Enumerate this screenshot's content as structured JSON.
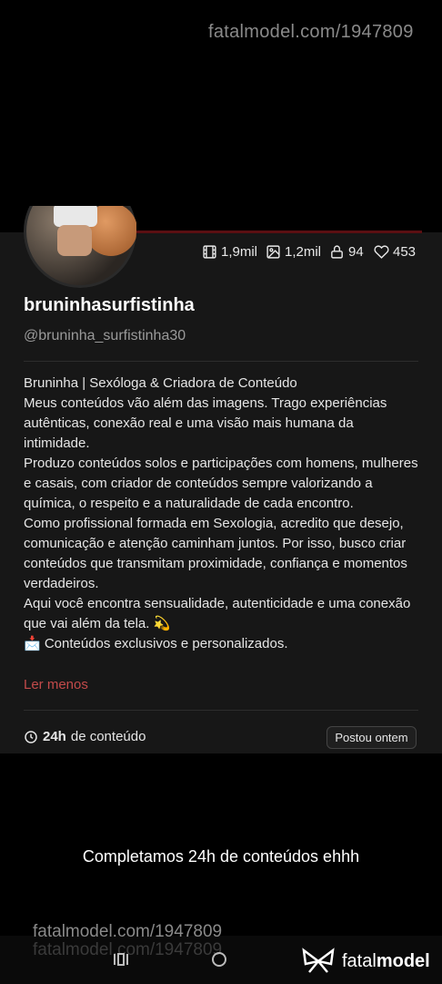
{
  "watermark": "fatalmodel.com/1947809",
  "profile": {
    "username": "bruninhasurfistinha",
    "handle": "@bruninha_surfistinha30"
  },
  "stats": {
    "videos": "1,9mil",
    "photos": "1,2mil",
    "locked": "94",
    "likes": "453"
  },
  "bio": [
    "Bruninha | Sexóloga & Criadora de Conteúdo",
    "Meus conteúdos vão além das imagens. Trago experiências autênticas, conexão real e uma visão mais humana da intimidade.",
    "Produzo conteúdos solos e participações com homens, mulheres e casais, com criador de conteúdos sempre valorizando a química, o respeito e a naturalidade de cada encontro.",
    "Como profissional formada em Sexologia, acredito que desejo, comunicação e atenção caminham juntos. Por isso, busco criar conteúdos que transmitam proximidade, confiança e momentos verdadeiros.",
    "Aqui você encontra sensualidade, autenticidade e uma conexão que vai além da tela. 💫",
    "📩 Conteúdos exclusivos e personalizados."
  ],
  "ler_menos": "Ler menos",
  "content_time": {
    "value": "24h",
    "suffix": "de conteúdo"
  },
  "posted_label": "Postou ontem",
  "caption": "Completamos 24h de conteúdos ehhh",
  "brand": {
    "name_light": "fatal",
    "name_bold": "model"
  },
  "accent_color": "#c24a4a"
}
